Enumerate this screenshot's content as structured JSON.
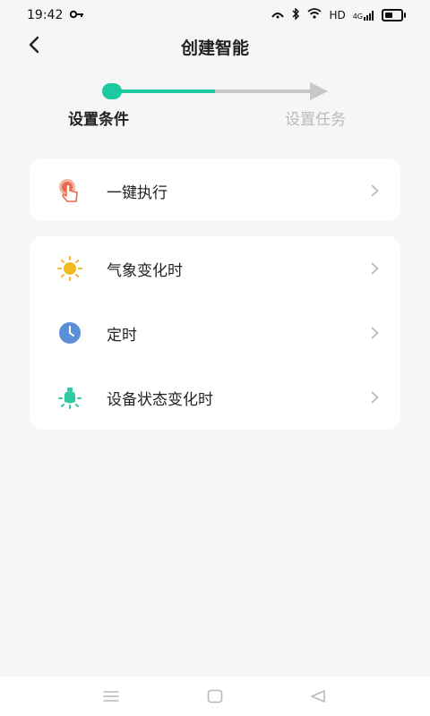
{
  "status_bar": {
    "time": "19:42",
    "key_icon": "key-icon",
    "right_icons": [
      "cast-icon",
      "bluetooth-icon",
      "wifi-icon"
    ],
    "hd": "HD",
    "network": "4G",
    "battery_icon": "battery-icon"
  },
  "header": {
    "title": "创建智能",
    "back_icon": "chevron-left-icon"
  },
  "stepper": {
    "step1": "设置条件",
    "step2": "设置任务",
    "active_color": "#1ccaa0",
    "inactive_color": "#c8c8c8"
  },
  "conditions": {
    "group1": [
      {
        "label": "一键执行",
        "icon": "hand-tap-icon",
        "icon_color": "#e86b4f"
      }
    ],
    "group2": [
      {
        "label": "气象变化时",
        "icon": "sun-icon",
        "icon_color": "#f5b820"
      },
      {
        "label": "定时",
        "icon": "clock-icon",
        "icon_color": "#5b8fd8"
      },
      {
        "label": "设备状态变化时",
        "icon": "device-bulb-icon",
        "icon_color": "#2fc9a4"
      }
    ]
  },
  "nav_bar": {
    "items": [
      "menu-icon",
      "home-icon",
      "back-triangle-icon"
    ]
  }
}
